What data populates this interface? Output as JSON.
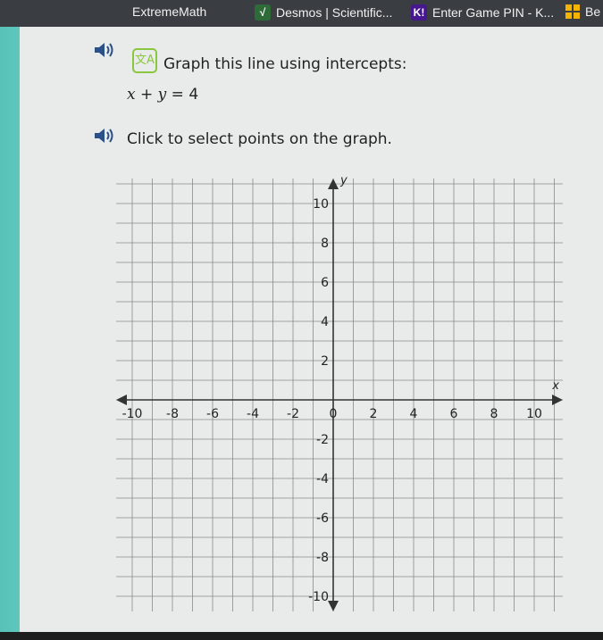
{
  "bookmarks": [
    {
      "label": "ExtremeMath",
      "icon": "extrememath-icon"
    },
    {
      "label": "Desmos | Scientific...",
      "icon": "desmos-icon"
    },
    {
      "label": "Enter Game PIN - K...",
      "icon": "kahoot-icon"
    },
    {
      "label": "Be",
      "icon": "grid-app-icon"
    }
  ],
  "question": {
    "prompt": "Graph this line using intercepts:",
    "equation": {
      "x": "x",
      "plus": "+",
      "y": "y",
      "equals": "=",
      "rhs": "4"
    },
    "instruction": "Click to select points on the graph."
  },
  "graph": {
    "x_axis_label": "x",
    "y_axis_label": "y",
    "x_tick_labels": [
      "-10",
      "-8",
      "-6",
      "-4",
      "-2",
      "0",
      "2",
      "4",
      "6",
      "8",
      "10"
    ],
    "y_tick_labels": [
      "10",
      "8",
      "6",
      "4",
      "2",
      "-2",
      "-4",
      "-6",
      "-8",
      "-10"
    ]
  },
  "colors": {
    "teal": "#5ec7bc",
    "grid": "#8a8a8a",
    "axis": "#333333",
    "icon_green": "#8ac63f"
  }
}
